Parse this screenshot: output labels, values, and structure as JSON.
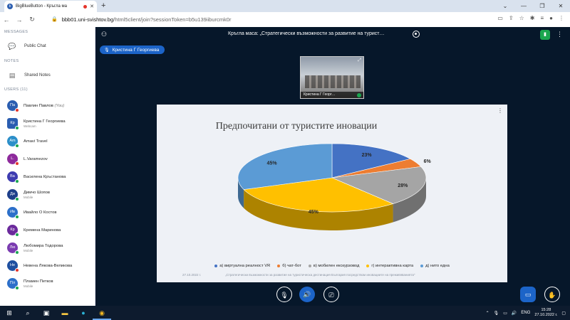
{
  "browser": {
    "tab_title": "BigBlueButton - Кръгла ма",
    "favicon": "b",
    "new_tab": "+",
    "url_host": "bbb01.uni-svishtov.bg",
    "url_path": "/html5client/join?sessionToken=b5u139iiburcmk0r"
  },
  "sidebar": {
    "messages_title": "MESSAGES",
    "public_chat": "Public Chat",
    "notes_title": "NOTES",
    "shared_notes": "Shared Notes",
    "users_title": "USERS (11)",
    "users": [
      {
        "initials": "Па",
        "name": "Павлин Павлов",
        "you": "(You)",
        "sub": "",
        "color": "#2a5db0",
        "dot": "#e5352b",
        "square": false
      },
      {
        "initials": "Кр",
        "name": "Кристина Г Георгиева",
        "you": "",
        "sub": "Webcam",
        "color": "#2a5db0",
        "dot": "#1ba64f",
        "square": true
      },
      {
        "initials": "Am",
        "name": "Amavi Travel",
        "you": "",
        "sub": "",
        "color": "#2c8fc9",
        "dot": "#1ba64f",
        "square": false
      },
      {
        "initials": "L.",
        "name": "L.Varamezov",
        "you": "",
        "sub": "",
        "color": "#8e2a9c",
        "dot": "#e5352b",
        "square": false
      },
      {
        "initials": "Ва",
        "name": "Василена Кръстанова",
        "you": "",
        "sub": "",
        "color": "#3d3bb0",
        "dot": "#1ba64f",
        "square": false
      },
      {
        "initials": "Ди",
        "name": "Димчо Шопов",
        "you": "",
        "sub": "Mobile",
        "color": "#1e3f8a",
        "dot": "#1ba64f",
        "square": false
      },
      {
        "initials": "Ив",
        "name": "Ивайло О Костов",
        "you": "",
        "sub": "",
        "color": "#2c6fc9",
        "dot": "#1ba64f",
        "square": false
      },
      {
        "initials": "Кр",
        "name": "Кремена Маринова",
        "you": "",
        "sub": "",
        "color": "#6b2a9c",
        "dot": "#1ba64f",
        "square": false
      },
      {
        "initials": "Лю",
        "name": "Любомира Тодорова",
        "you": "",
        "sub": "Mobile",
        "color": "#7a3bb0",
        "dot": "#1ba64f",
        "square": false
      },
      {
        "initials": "Не",
        "name": "Невена Лякова-Великова",
        "you": "",
        "sub": "",
        "color": "#1e4fa0",
        "dot": "#e5352b",
        "square": false
      },
      {
        "initials": "Пл",
        "name": "Пламен Петков",
        "you": "",
        "sub": "Mobile",
        "color": "#2c6fc9",
        "dot": "#1ba64f",
        "square": false
      }
    ]
  },
  "main": {
    "meeting_title": "Кръгла маса: „Стратегически възможности за развитие на турист…",
    "presenter": "Кристина Г Георгиева",
    "video_caption": "Кристина Г Георг…"
  },
  "slide": {
    "footer_date": "27.10.2022 г.",
    "footer_text": "„Стратегически възможности за развитие на туристическа дестинация България посредством иновациите на преживяванията\""
  },
  "chart_data": {
    "type": "pie",
    "title": "Предпочитани от туристите иновации",
    "categories": [
      "а) виртуална реалност VR",
      "б) чат-бот",
      "в) мобилен екскурзовод",
      "г) интерактивна карта",
      "д) нито една"
    ],
    "values": [
      23,
      6,
      28,
      45,
      45
    ],
    "labels": [
      "23%",
      "6%",
      "28%",
      "45%",
      "45%"
    ],
    "colors": [
      "#4472c4",
      "#ed7d31",
      "#a5a5a5",
      "#ffc000",
      "#5b9bd5"
    ],
    "legend_position": "bottom"
  },
  "taskbar": {
    "lang": "ENG",
    "time": "15:28",
    "date": "27.10.2022 г."
  }
}
